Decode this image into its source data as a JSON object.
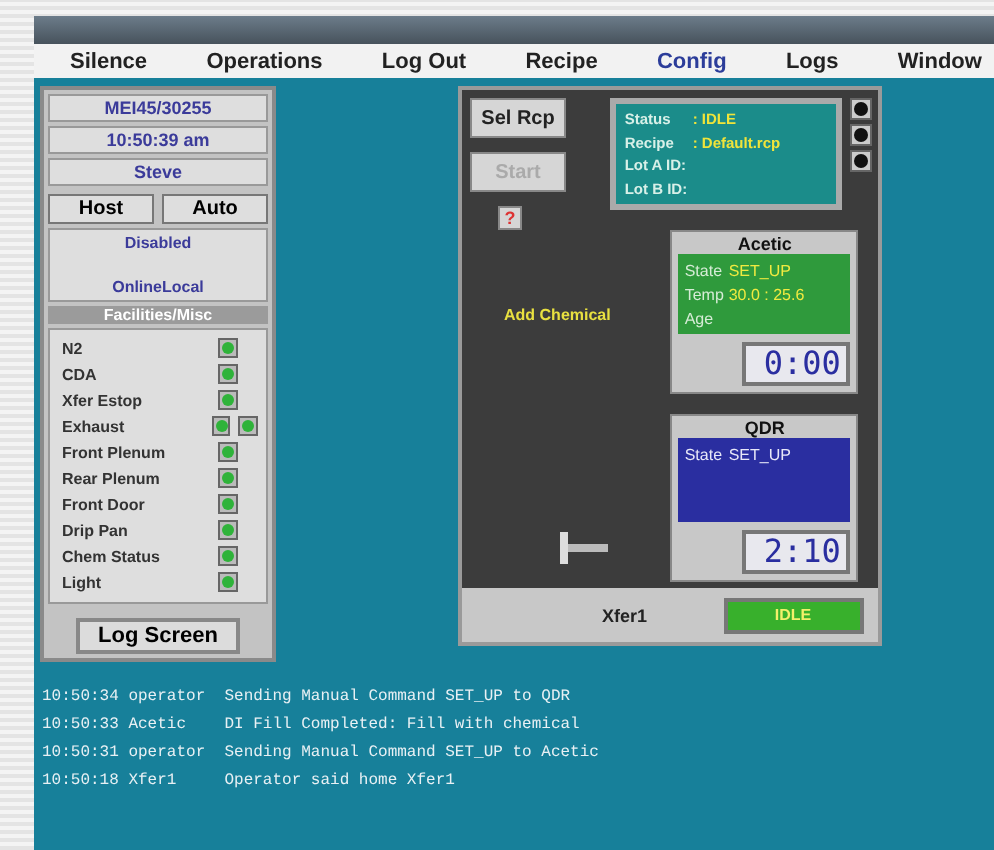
{
  "menu": [
    {
      "label": "Silence",
      "selected": false
    },
    {
      "label": "Operations",
      "selected": false
    },
    {
      "label": "Log Out",
      "selected": false
    },
    {
      "label": "Recipe",
      "selected": false
    },
    {
      "label": "Config",
      "selected": true
    },
    {
      "label": "Logs",
      "selected": false
    },
    {
      "label": "Window",
      "selected": false
    }
  ],
  "left_panel": {
    "tool_id": "MEI45/30255",
    "time": "10:50:39 am",
    "user": "Steve",
    "mode_buttons": [
      "Host",
      "Auto"
    ],
    "status_lines": [
      "Disabled",
      "OnlineLocal"
    ],
    "facilities_header": "Facilities/Misc",
    "facilities": [
      {
        "name": "N2",
        "on": true,
        "extra_indicator": false
      },
      {
        "name": "CDA",
        "on": true,
        "extra_indicator": false
      },
      {
        "name": "Xfer Estop",
        "on": true,
        "extra_indicator": false
      },
      {
        "name": "Exhaust",
        "on": true,
        "extra_indicator": true
      },
      {
        "name": "Front Plenum",
        "on": true,
        "extra_indicator": false
      },
      {
        "name": "Rear Plenum",
        "on": true,
        "extra_indicator": false
      },
      {
        "name": "Front Door",
        "on": true,
        "extra_indicator": false
      },
      {
        "name": "Drip Pan",
        "on": true,
        "extra_indicator": false
      },
      {
        "name": "Chem Status",
        "on": true,
        "extra_indicator": false
      },
      {
        "name": "Light",
        "on": true,
        "extra_indicator": false
      }
    ],
    "log_button": "Log Screen"
  },
  "center_panel": {
    "buttons": [
      {
        "label": "Sel Rcp",
        "disabled": false
      },
      {
        "label": "Start",
        "disabled": true
      }
    ],
    "help_button": "?",
    "status": [
      {
        "label": "Status",
        "value": ": IDLE"
      },
      {
        "label": "Recipe",
        "value": ": Default.rcp"
      },
      {
        "label": "Lot A ID:"
      },
      {
        "label": "Lot B ID:"
      }
    ],
    "add_chemical": "Add Chemical",
    "tanks": [
      {
        "title": "Acetic",
        "kind": "green",
        "fields": [
          {
            "label": "State",
            "value": "SET_UP"
          },
          {
            "label": "Temp",
            "value": "30.0 : 25.6"
          },
          {
            "label": "Age"
          }
        ],
        "timer": "0:00"
      },
      {
        "title": "QDR",
        "kind": "blue",
        "fields": [
          {
            "label": "State",
            "value": "SET_UP"
          }
        ],
        "timer": "2:10"
      }
    ],
    "robot_label": "Xfer1",
    "robot_state": "IDLE"
  },
  "log": [
    {
      "time": "10:50:34",
      "source": "operator",
      "message": "Sending Manual Command SET_UP to QDR"
    },
    {
      "time": "10:50:33",
      "source": "Acetic",
      "message": "DI Fill Completed: Fill with chemical"
    },
    {
      "time": "10:50:31",
      "source": "operator",
      "message": "Sending Manual Command SET_UP to Acetic"
    },
    {
      "time": "10:50:18",
      "source": "Xfer1",
      "message": "Operator said home Xfer1"
    }
  ]
}
